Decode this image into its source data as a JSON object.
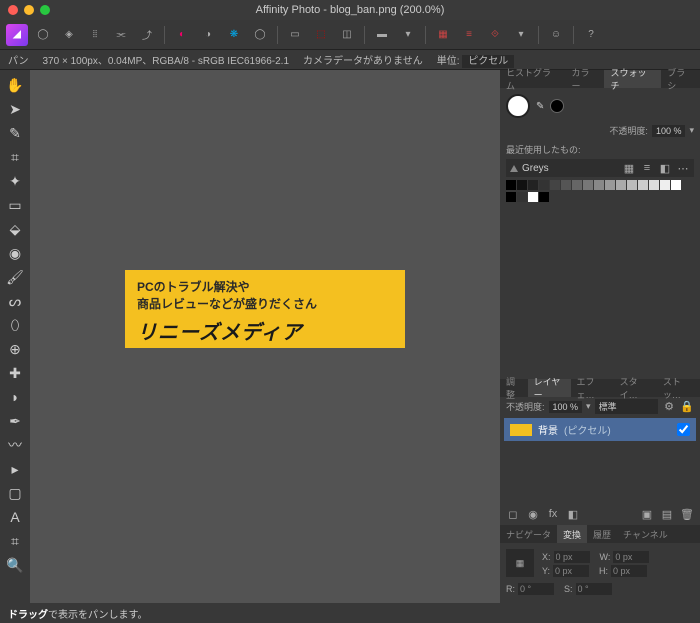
{
  "titlebar": {
    "title": "Affinity Photo - blog_ban.png (200.0%)"
  },
  "contextbar": {
    "tool": "パン",
    "dims": "370 × 100px、0.04MP、RGBA/8 - sRGB IEC61966-2.1",
    "camera": "カメラデータがありません",
    "unit_label": "単位:",
    "unit_value": "ピクセル"
  },
  "canvas": {
    "line1": "PCのトラブル解決や",
    "line2": "商品レビューなどが盛りだくさん",
    "line3": "リニーズメディア"
  },
  "swatches": {
    "tabs": [
      "ヒストグラム",
      "カラー",
      "スウォッチ",
      "ブラシ"
    ],
    "active_tab": "スウォッチ",
    "opacity_label": "不透明度:",
    "opacity_value": "100 %",
    "recent_label": "最近使用したもの:",
    "preset": "Greys",
    "greys": [
      "#000",
      "#111",
      "#222",
      "#333",
      "#444",
      "#555",
      "#666",
      "#777",
      "#888",
      "#999",
      "#aaa",
      "#bbb",
      "#ccc",
      "#ddd",
      "#eee",
      "#fff"
    ],
    "recent": [
      "#000",
      "#333",
      "#fff",
      "#000"
    ]
  },
  "layers": {
    "tabs": [
      "調整",
      "レイヤー",
      "エフェ…",
      "スタイ…",
      "ストッ…"
    ],
    "active_tab": "レイヤー",
    "opacity_label": "不透明度:",
    "opacity_value": "100 %",
    "blend": "標準",
    "layer_name": "背景",
    "layer_type": "(ピクセル)"
  },
  "transform": {
    "tabs": [
      "ナビゲータ",
      "変換",
      "履歴",
      "チャンネル"
    ],
    "active_tab": "変換",
    "x_label": "X:",
    "x_value": "0 px",
    "y_label": "Y:",
    "y_value": "0 px",
    "w_label": "W:",
    "w_value": "0 px",
    "h_label": "H:",
    "h_value": "0 px",
    "r_label": "R:",
    "r_value": "0 °",
    "s_label": "S:",
    "s_value": "0 °"
  },
  "statusbar": {
    "text": "ドラッグで表示をパンします。"
  }
}
